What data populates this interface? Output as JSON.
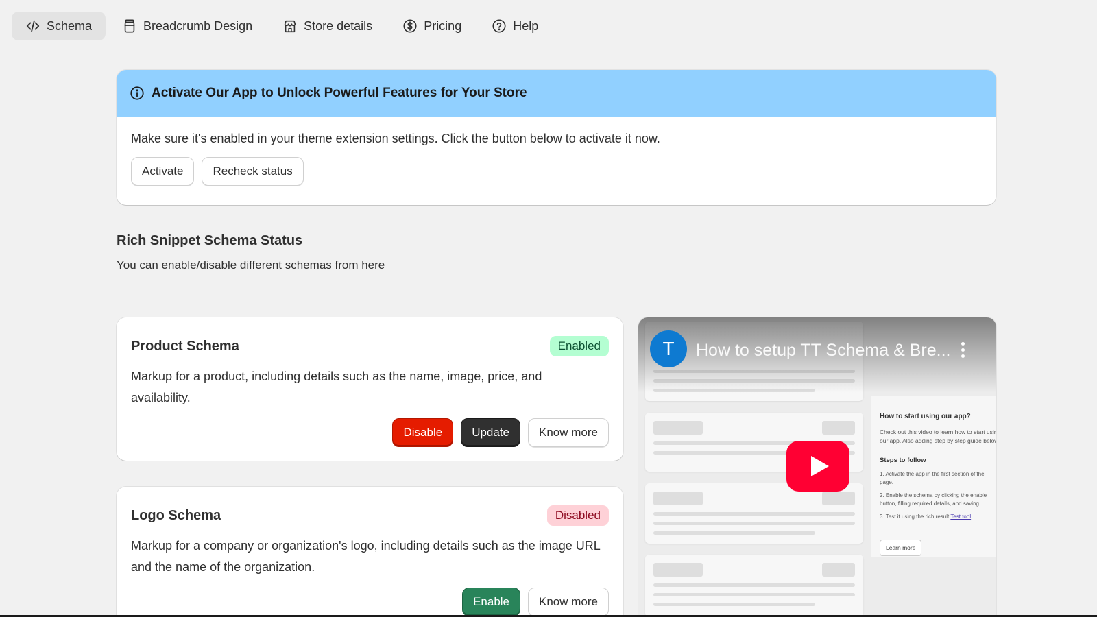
{
  "nav": {
    "tabs": [
      {
        "label": "Schema",
        "icon": "code-icon",
        "active": true
      },
      {
        "label": "Breadcrumb Design",
        "icon": "jar-icon",
        "active": false
      },
      {
        "label": "Store details",
        "icon": "store-icon",
        "active": false
      },
      {
        "label": "Pricing",
        "icon": "dollar-circle-icon",
        "active": false
      },
      {
        "label": "Help",
        "icon": "question-circle-icon",
        "active": false
      }
    ]
  },
  "banner": {
    "icon": "info-icon",
    "title": "Activate Our App to Unlock Powerful Features for Your Store",
    "text": "Make sure it's enabled in your theme extension settings. Click the button below to activate it now.",
    "activate_label": "Activate",
    "recheck_label": "Recheck status",
    "color": "#91d0ff"
  },
  "section": {
    "title": "Rich Snippet Schema Status",
    "subtitle": "You can enable/disable different schemas from here"
  },
  "schemas": [
    {
      "title": "Product Schema",
      "status": "Enabled",
      "description": "Markup for a product, including details such as the name, image, price, and availability.",
      "actions": {
        "disable": "Disable",
        "update": "Update",
        "know_more": "Know more"
      }
    },
    {
      "title": "Logo Schema",
      "status": "Disabled",
      "description": "Markup for a company or organization's logo, including details such as the image URL and the name of the organization.",
      "actions": {
        "enable": "Enable",
        "know_more": "Know more"
      }
    }
  ],
  "video": {
    "channel_initial": "T",
    "title": "How to setup TT Schema & Bre...",
    "side_heading": "How to start using our app?",
    "side_intro": "Check out this video to learn how to start using our app. Also adding step by step guide below.",
    "steps_heading": "Steps to follow",
    "steps": [
      "1. Activate the app in the first section of the page.",
      "2. Enable the schema by clicking the enable button, filling required details, and saving.",
      "3. Test it using the rich result"
    ],
    "test_link": "Test tool",
    "learn_more": "Learn more"
  },
  "colors": {
    "enabled_badge": "#b4fed2",
    "disabled_badge": "#fed1d7",
    "disable_button": "#e51c00",
    "update_button": "#303030",
    "enable_button": "#29845a"
  }
}
